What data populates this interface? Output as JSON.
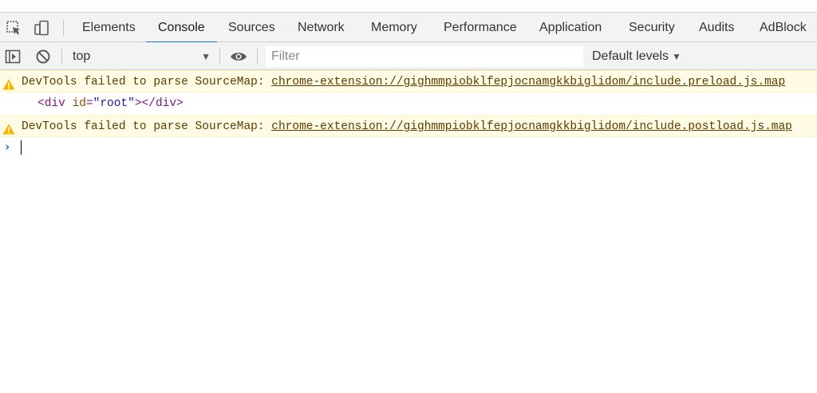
{
  "tabs": [
    {
      "label": "Elements"
    },
    {
      "label": "Console"
    },
    {
      "label": "Sources"
    },
    {
      "label": "Network"
    },
    {
      "label": "Memory"
    },
    {
      "label": "Performance"
    },
    {
      "label": "Application"
    },
    {
      "label": "Security"
    },
    {
      "label": "Audits"
    },
    {
      "label": "AdBlock"
    }
  ],
  "active_tab": "Console",
  "icons": {
    "inspect": "inspect-element-icon",
    "device": "device-toolbar-icon",
    "sidebar": "show-sidebar-icon",
    "clear": "clear-console-icon",
    "eye": "live-expression-icon",
    "warning": "warning-icon",
    "prompt": "prompt-chevron-icon"
  },
  "toolbar": {
    "context": "top",
    "filter_placeholder": "Filter",
    "levels": "Default levels"
  },
  "messages": [
    {
      "type": "warning",
      "text": "DevTools failed to parse SourceMap: ",
      "link": "chrome-extension://gighmmpiobklfepjocnamgkkbiglidom/include.preload.js.map"
    },
    {
      "type": "element",
      "tag_open": "<div",
      "attr_name": "id",
      "attr_value": "\"root\"",
      "tag_close": "></div>"
    },
    {
      "type": "warning",
      "text": "DevTools failed to parse SourceMap: ",
      "link": "chrome-extension://gighmmpiobklfepjocnamgkkbiglidom/include.postload.js.map"
    }
  ],
  "colors": {
    "accent": "#1a73e8",
    "warning_bg": "#fffbe5",
    "warning_text": "#5c3c00",
    "warning_icon": "#f2b600"
  }
}
